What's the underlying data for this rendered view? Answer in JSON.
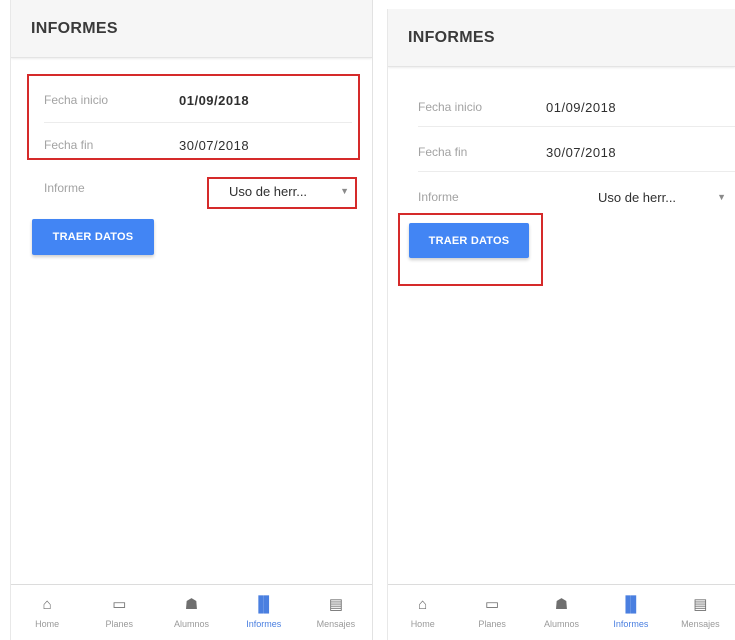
{
  "left": {
    "header_title": "INFORMES",
    "fecha_inicio_label": "Fecha inicio",
    "fecha_inicio_value": "01/09/2018",
    "fecha_fin_label": "Fecha fin",
    "fecha_fin_value": "30/07/2018",
    "informe_label": "Informe",
    "informe_value": "Uso de herr...",
    "button_label": "TRAER DATOS"
  },
  "right": {
    "header_title": "INFORMES",
    "fecha_inicio_label": "Fecha inicio",
    "fecha_inicio_value": "01/09/2018",
    "fecha_fin_label": "Fecha fin",
    "fecha_fin_value": "30/07/2018",
    "informe_label": "Informe",
    "informe_value": "Uso de herr...",
    "button_label": "TRAER DATOS"
  },
  "nav": {
    "items": [
      {
        "label": "Home",
        "icon": "home-icon"
      },
      {
        "label": "Planes",
        "icon": "clipboard-icon"
      },
      {
        "label": "Alumnos",
        "icon": "people-icon"
      },
      {
        "label": "Informes",
        "icon": "bar-chart-icon",
        "active": true
      },
      {
        "label": "Mensajes",
        "icon": "message-icon"
      }
    ]
  },
  "colors": {
    "accent": "#4285f4",
    "highlight": "#d52a2a",
    "active_nav": "#4a7fe0"
  }
}
